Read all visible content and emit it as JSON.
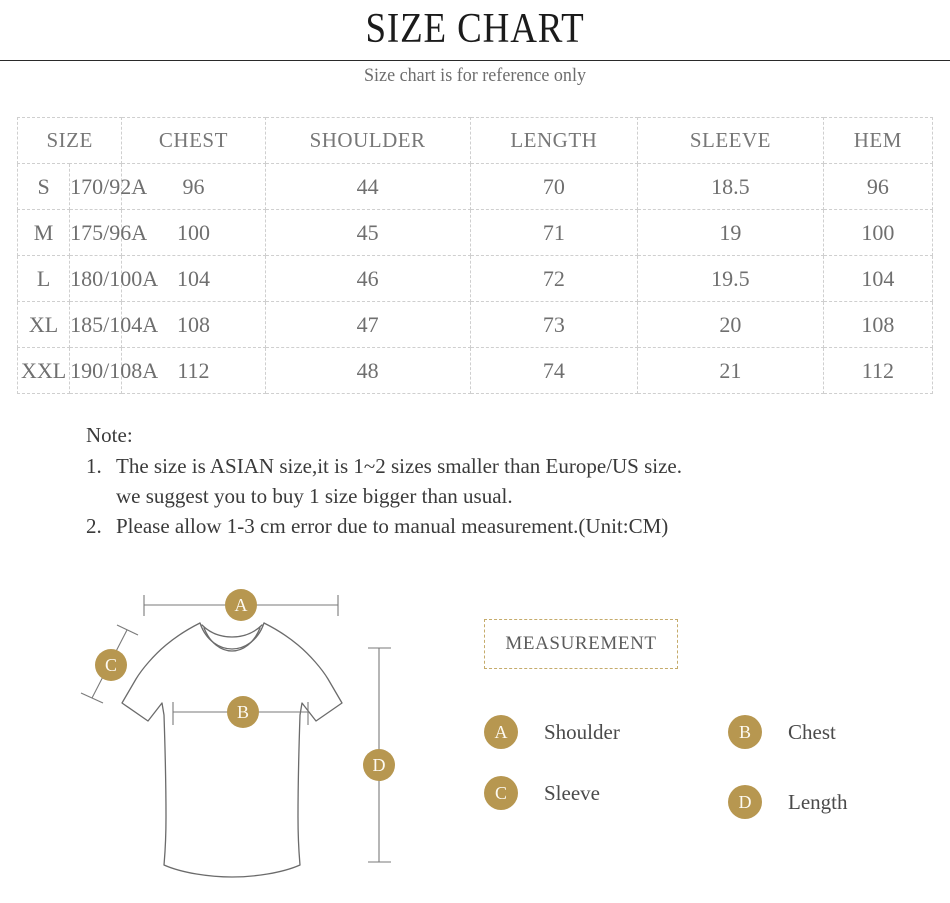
{
  "header": {
    "title": "SIZE CHART",
    "subtitle": "Size chart is for reference only"
  },
  "table": {
    "headers": [
      "SIZE",
      "CHEST",
      "SHOULDER",
      "LENGTH",
      "SLEEVE",
      "HEM"
    ],
    "rows": [
      {
        "size": "S",
        "code": "170/92A",
        "chest": "96",
        "shoulder": "44",
        "length": "70",
        "sleeve": "18.5",
        "hem": "96"
      },
      {
        "size": "M",
        "code": "175/96A",
        "chest": "100",
        "shoulder": "45",
        "length": "71",
        "sleeve": "19",
        "hem": "100"
      },
      {
        "size": "L",
        "code": "180/100A",
        "chest": "104",
        "shoulder": "46",
        "length": "72",
        "sleeve": "19.5",
        "hem": "104"
      },
      {
        "size": "XL",
        "code": "185/104A",
        "chest": "108",
        "shoulder": "47",
        "length": "73",
        "sleeve": "20",
        "hem": "108"
      },
      {
        "size": "XXL",
        "code": "190/108A",
        "chest": "112",
        "shoulder": "48",
        "length": "74",
        "sleeve": "21",
        "hem": "112"
      }
    ]
  },
  "note": {
    "title": "Note:",
    "items": [
      {
        "num": "1.",
        "line1": "The size is ASIAN size,it is 1~2 sizes smaller than Europe/US size.",
        "line2": "we suggest you to buy 1 size bigger than usual."
      },
      {
        "num": "2.",
        "line1": "Please allow 1-3 cm error due to manual measurement.(Unit:CM)",
        "line2": ""
      }
    ]
  },
  "measurement": {
    "box_label": "MEASUREMENT",
    "legend": [
      {
        "key": "A",
        "label": "Shoulder"
      },
      {
        "key": "B",
        "label": "Chest"
      },
      {
        "key": "C",
        "label": "Sleeve"
      },
      {
        "key": "D",
        "label": "Length"
      }
    ]
  },
  "diagram": {
    "markers": [
      {
        "key": "A",
        "meaning": "shoulder-width-dimension"
      },
      {
        "key": "B",
        "meaning": "chest-width-dimension"
      },
      {
        "key": "C",
        "meaning": "sleeve-length-dimension"
      },
      {
        "key": "D",
        "meaning": "body-length-dimension"
      }
    ]
  },
  "colors": {
    "gold": "#b79750",
    "table_border": "#cfcfcf",
    "table_text": "#6f6f6f",
    "title_text": "#1b1b1b",
    "subtitle_text": "#6d6d6d",
    "outline": "#6b6b6b"
  }
}
